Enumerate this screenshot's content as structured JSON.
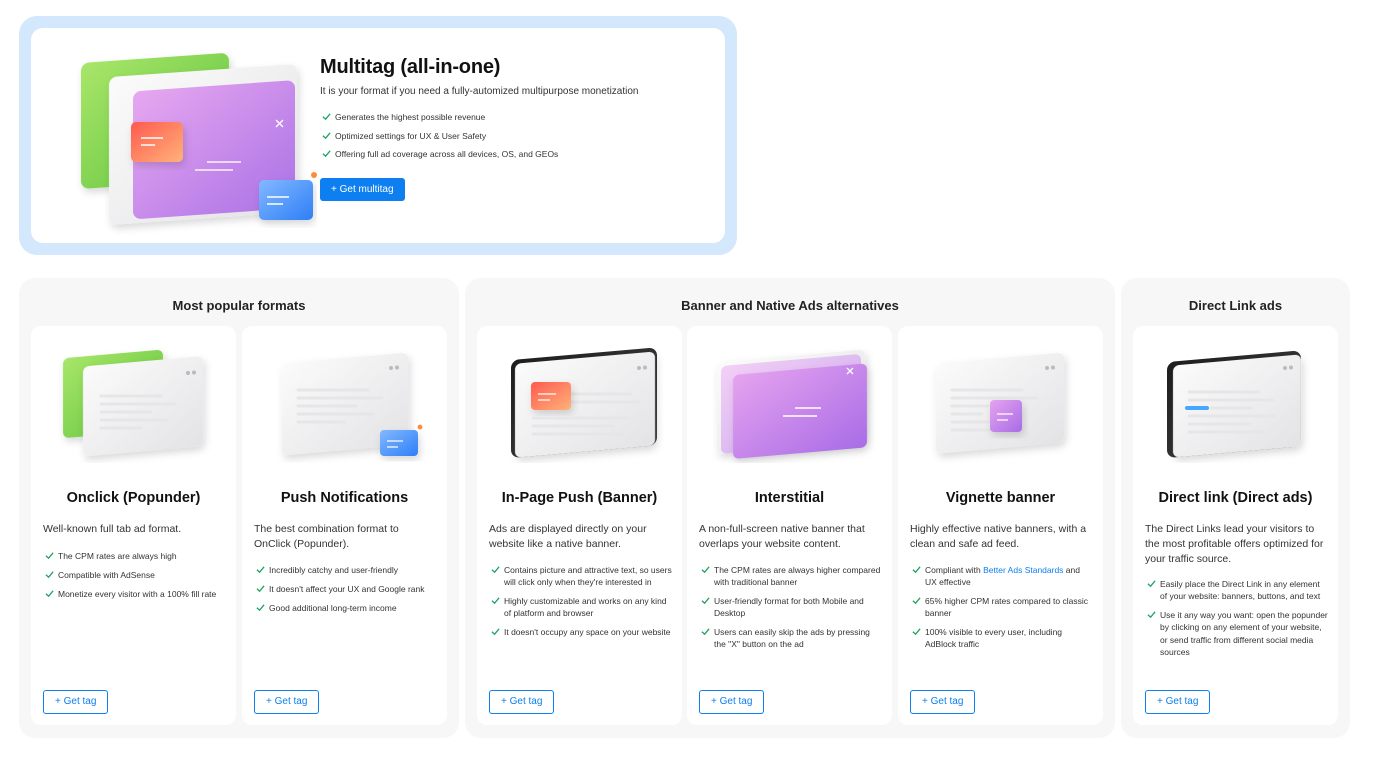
{
  "hero": {
    "title": "Multitag (all-in-one)",
    "subtitle": "It is your format if you need a fully-automized multipurpose monetization",
    "features": [
      "Generates the highest possible revenue",
      "Optimized settings for UX & User Safety",
      "Offering full ad coverage across all devices, OS, and GEOs"
    ],
    "button_label": "+ Get multitag"
  },
  "groups": [
    {
      "title": "Most popular formats"
    },
    {
      "title": "Banner and Native Ads alternatives"
    },
    {
      "title": "Direct Link ads"
    }
  ],
  "cards": [
    {
      "title": "Onclick (Popunder)",
      "description": "Well-known full tab ad format.",
      "features": [
        "The CPM rates are always high",
        "Compatible with AdSense",
        "Monetize every visitor with a 100% fill rate"
      ],
      "button_label": "+ Get tag"
    },
    {
      "title": "Push Notifications",
      "description": "The best combination format to OnClick (Popunder).",
      "features": [
        "Incredibly catchy and user-friendly",
        "It doesn't affect your UX and Google rank",
        "Good additional long-term income"
      ],
      "button_label": "+ Get tag"
    },
    {
      "title": "In-Page Push (Banner)",
      "description": "Ads are displayed directly on your website like a native banner.",
      "features": [
        "Contains picture and attractive text, so users will click only when they're interested in",
        "Highly customizable and works on any kind of platform and browser",
        "It doesn't occupy any space on your website"
      ],
      "button_label": "+ Get tag"
    },
    {
      "title": "Interstitial",
      "description": "A non-full-screen native banner that overlaps your website content.",
      "features": [
        "The CPM rates are always higher compared with traditional banner",
        "User-friendly format for both Mobile and Desktop",
        "Users can easily skip the ads by pressing the \"X\" button on the ad"
      ],
      "button_label": "+ Get tag"
    },
    {
      "title": "Vignette banner",
      "description": "Highly effective native banners, with a clean and safe ad feed.",
      "feature0_prefix": "Compliant with ",
      "feature0_link": "Better Ads Standards",
      "feature0_suffix": " and UX effective",
      "features": [
        "",
        "65% higher CPM rates compared to classic banner",
        "100% visible to every user, including AdBlock traffic"
      ],
      "button_label": "+ Get tag"
    },
    {
      "title": "Direct link (Direct ads)",
      "description": "The Direct Links lead your visitors to the most profitable offers optimized for your traffic source.",
      "features": [
        "Easily place the Direct Link in any element of your website: banners, buttons, and text",
        "Use it any way you want: open the popunder by clicking on any element of your website, or send traffic from different social media sources"
      ],
      "button_label": "+ Get tag"
    }
  ],
  "colors": {
    "accent": "#0d7ff0",
    "check": "#1aa260",
    "hero_border": "#d3e7fd",
    "group_bg": "#f7f7f8"
  },
  "icons": {
    "check": "check-icon",
    "close": "close-icon"
  }
}
